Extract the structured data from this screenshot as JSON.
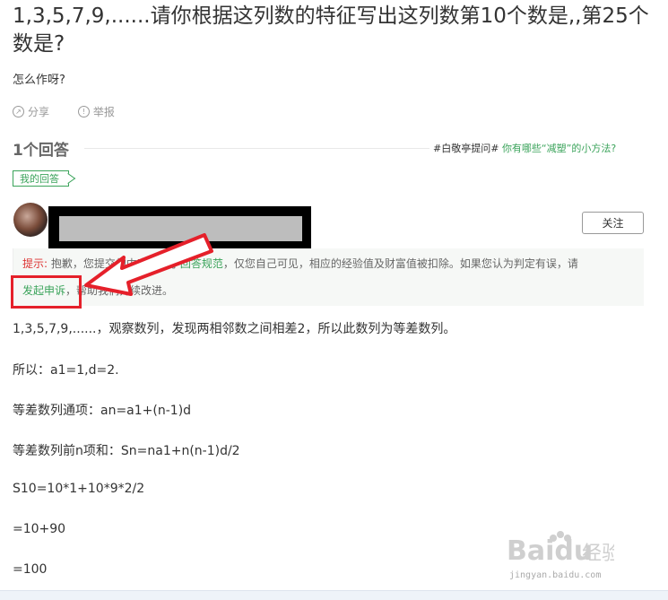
{
  "question": {
    "title": "1,3,5,7,9,......请你根据这列数的特征写出这列数第10个数是,,第25个数是?",
    "description": "怎么作呀?"
  },
  "actions": {
    "share": "分享",
    "report": "举报"
  },
  "answers": {
    "count_label": "1个回答",
    "promo_prefix": "#白敬亭提问#",
    "promo_link": "你有哪些“减塑”的小方法?",
    "my_answer_tag": "我的回答",
    "follow_button": "关注"
  },
  "notice": {
    "label": "提示:",
    "part1": "抱歉，您提交的内容违反了",
    "link_rules": "回答规范",
    "part2": "，仅您自己可见，相应的经验值及财富值被扣除。如果您认为判定有误，请",
    "link_appeal": "发起申诉",
    "part3": "，帮助我们持续改进。"
  },
  "content": [
    "1,3,5,7,9,......，观察数列，发现两相邻数之间相差2，所以此数列为等差数列。",
    "所以：a1=1,d=2.",
    "等差数列通项：an=a1+(n-1)d",
    "等差数列前n项和：Sn=na1+n(n-1)d/2",
    "S10=10*1+10*9*2/2",
    "=10+90",
    "=100"
  ],
  "watermark": {
    "brand": "Baidu",
    "text": "经验",
    "url": "jingyan.baidu.com"
  },
  "colors": {
    "green": "#3aa35a",
    "red_annotation": "#e5202a",
    "notice_red": "#dd3333"
  }
}
